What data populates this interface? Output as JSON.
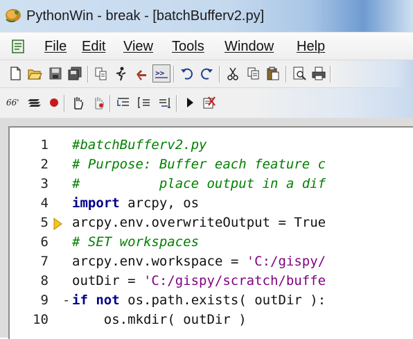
{
  "window": {
    "title": "PythonWin - break - [batchBufferv2.py]"
  },
  "menu": {
    "items": [
      "File",
      "Edit",
      "View",
      "Tools",
      "Window",
      "Help"
    ]
  },
  "toolbar1": {
    "icons": [
      "new-file-icon",
      "open-folder-icon",
      "save-icon",
      "save-all-icon",
      "grep-icon",
      "run-icon",
      "import-icon",
      "check-icon",
      "undo-icon",
      "redo-icon",
      "cut-icon",
      "copy-icon",
      "paste-icon",
      "print-preview-icon",
      "print-icon"
    ]
  },
  "toolbar2": {
    "icons": [
      "watch-icon",
      "stack-icon",
      "breakpoint-icon",
      "hand-icon",
      "clear-hand-icon",
      "step-into-icon",
      "step-over-icon",
      "step-out-icon",
      "go-icon",
      "close-debugger-icon"
    ]
  },
  "editor": {
    "lines": [
      {
        "num": "1",
        "text": "#batchBufferv2.py"
      },
      {
        "num": "2",
        "text": "# Purpose: Buffer each feature c"
      },
      {
        "num": "3",
        "text": "#          place output in a dif"
      },
      {
        "num": "4",
        "text": "import arcpy, os"
      },
      {
        "num": "5",
        "text": "arcpy.env.overwriteOutput = True"
      },
      {
        "num": "6",
        "text": "# SET workspaces"
      },
      {
        "num": "7",
        "text": "arcpy.env.workspace = 'C:/gispy/"
      },
      {
        "num": "8",
        "text": "outDir = 'C:/gispy/scratch/buffe"
      },
      {
        "num": "9",
        "text": "if not os.path.exists( outDir ):"
      },
      {
        "num": "10",
        "text": "    os.mkdir( outDir )"
      }
    ],
    "current_line": "5",
    "fold_line": "9",
    "colors": {
      "comment": "#008000",
      "keyword": "#00008b",
      "string": "#7f007f",
      "marker": "#f5c518"
    }
  }
}
